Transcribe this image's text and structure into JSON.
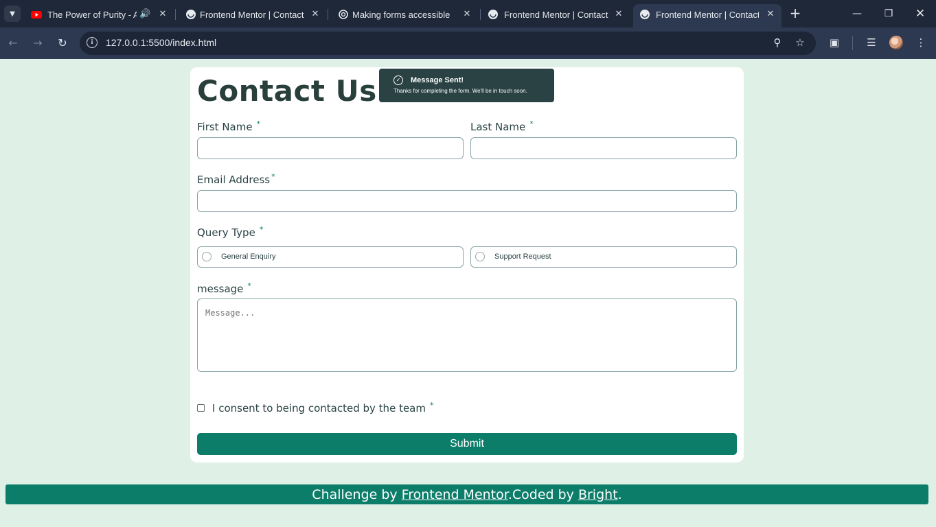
{
  "browser": {
    "tabs": [
      {
        "title": "The Power of Purity - Ap",
        "active": false
      },
      {
        "title": "Frontend Mentor | Contact fo",
        "active": false
      },
      {
        "title": "Making forms accessible",
        "active": false
      },
      {
        "title": "Frontend Mentor | Contact fo",
        "active": false
      },
      {
        "title": "Frontend Mentor | Contact fo",
        "active": true
      }
    ],
    "url": "127.0.0.1:5500/index.html"
  },
  "toast": {
    "title": "Message Sent!",
    "text": "Thanks for completing the form. We'll be in touch soon."
  },
  "form": {
    "heading": "Contact Us",
    "first_name_label": "First Name",
    "last_name_label": "Last Name",
    "email_label": "Email Address",
    "query_type_label": "Query Type",
    "query_options": [
      "General Enquiry",
      "Support Request"
    ],
    "message_label": "message",
    "message_placeholder": "Message...",
    "consent_label": "I consent to being contacted by the team",
    "required_mark": "*",
    "submit_label": "Submit"
  },
  "footer": {
    "prefix": "Challenge by ",
    "link1": "Frontend Mentor",
    "middle": ".Coded by ",
    "link2": "Bright",
    "suffix": "."
  },
  "colors": {
    "page_bg": "#dff1e7",
    "accent": "#0c7d69",
    "text": "#2a4244",
    "toast_bg": "#2a4244"
  }
}
